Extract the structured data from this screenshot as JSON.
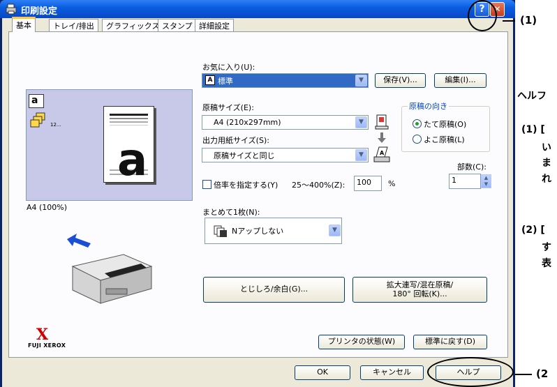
{
  "window": {
    "title": "印刷設定",
    "help_button": "?",
    "close_button": "✕"
  },
  "tabs": [
    "基本",
    "トレイ/排出",
    "グラフィックス",
    "スタンプ",
    "詳細設定"
  ],
  "preview": {
    "caption": "A4 (100%)",
    "paper_letter": "a",
    "small_icon_letter": "a",
    "stack_label": "12..."
  },
  "logo": {
    "brand": "FUJI XEROX"
  },
  "favorites": {
    "label": "お気に入り(U):",
    "value": "標準",
    "save_button": "保存(V)...",
    "edit_button": "編集(I)..."
  },
  "paper_size": {
    "label": "原稿サイズ(E):",
    "value": "A4 (210x297mm)"
  },
  "output_size": {
    "label": "出力用紙サイズ(S):",
    "value": "原稿サイズと同じ"
  },
  "orientation": {
    "title": "原稿の向き",
    "portrait": "たて原稿(O)",
    "landscape": "よこ原稿(L)",
    "selected": "portrait"
  },
  "scale": {
    "checkbox_label": "倍率を指定する(Y)",
    "range_label": "25〜400%(Z):",
    "value": "100",
    "unit": "%"
  },
  "copies": {
    "label": "部数(C):",
    "value": "1"
  },
  "nup": {
    "label": "まとめて1枚(N):",
    "value": "Nアップしない"
  },
  "buttons": {
    "binding": "とじしろ/余白(G)...",
    "enlarge_line1": "拡大連写/混在原稿/",
    "enlarge_line2": "180° 回転(K)...",
    "printer_status": "プリンタの状態(W)",
    "restore_default": "標準に戻す(D)",
    "ok": "OK",
    "cancel": "キャンセル",
    "help": "ヘルプ"
  },
  "annotations": {
    "callout_1": "(1)",
    "callout_2": "(2",
    "side_heading": "ヘルフ",
    "side_1_line1": "(1) [",
    "side_1_line2": "い",
    "side_1_line3": "ま",
    "side_1_line4": "れ",
    "side_2_line1": "(2) [",
    "side_2_line2": "す",
    "side_2_line3": "表"
  },
  "colors": {
    "title_bar": "#0a5de0",
    "selection": "#316ac5",
    "dialog_bg": "#ece9d8",
    "group_title": "#0046d5",
    "logo_red": "#cc0000"
  }
}
